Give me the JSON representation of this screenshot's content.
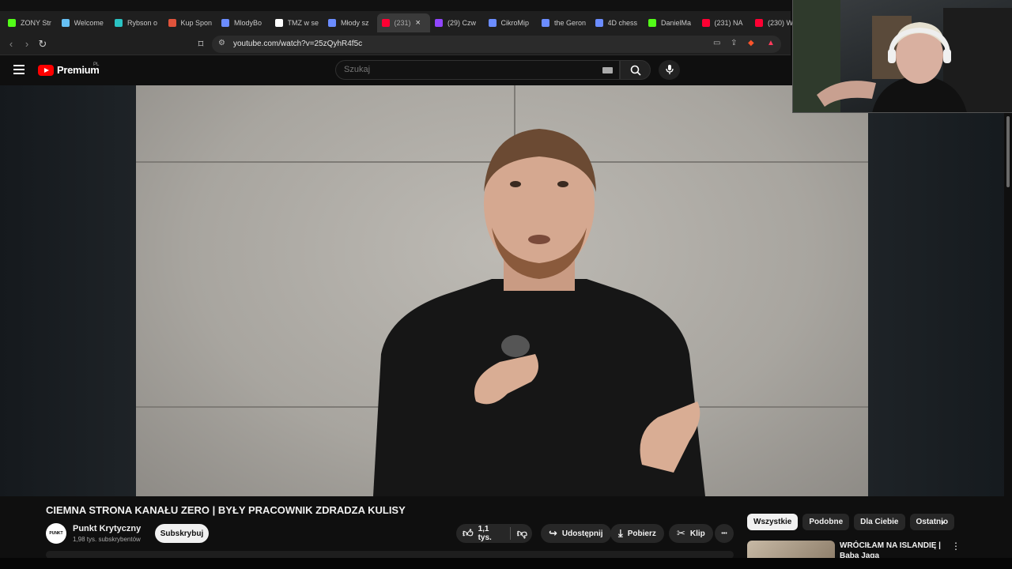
{
  "browser": {
    "tabs": [
      {
        "title": "ZONY Str",
        "favicon_color": "#53fc18",
        "active": false
      },
      {
        "title": "Welcome",
        "favicon_color": "#66c0f4",
        "active": false
      },
      {
        "title": "Rybson o",
        "favicon_color": "#2ac3c3",
        "active": false
      },
      {
        "title": "Kup Spon",
        "favicon_color": "#e0533b",
        "active": false
      },
      {
        "title": "MlodyBo",
        "favicon_color": "#6b8cff",
        "active": false
      },
      {
        "title": "TMZ w se",
        "favicon_color": "#ffffff",
        "active": false
      },
      {
        "title": "Młody sz",
        "favicon_color": "#6b8cff",
        "active": false
      },
      {
        "title": "(231)",
        "favicon_color": "#ff0033",
        "active": true
      },
      {
        "title": "(29) Czw",
        "favicon_color": "#9146ff",
        "active": false
      },
      {
        "title": "CikroMip",
        "favicon_color": "#6b8cff",
        "active": false
      },
      {
        "title": "the Geron",
        "favicon_color": "#6b8cff",
        "active": false
      },
      {
        "title": "4D chess",
        "favicon_color": "#6b8cff",
        "active": false
      },
      {
        "title": "DanielMa",
        "favicon_color": "#53fc18",
        "active": false
      },
      {
        "title": "(231) NA",
        "favicon_color": "#ff0033",
        "active": false
      },
      {
        "title": "(230) WO",
        "favicon_color": "#ff0033",
        "active": false
      }
    ],
    "tab_close_glyph": "×",
    "url": "youtube.com/watch?v=25zQyhR4f5c",
    "icons": {
      "back": "‹",
      "forward": "›",
      "reload": "↻",
      "bookmark": "⌑"
    }
  },
  "youtube": {
    "logo_text": "Premium",
    "logo_country": "PL",
    "search_placeholder": "Szukaj",
    "video": {
      "title": "CIEMNA STRONA KANAŁU ZERO | BYŁY PRACOWNIK ZDRADZA KULISY",
      "channel_name": "Punkt Krytyczny",
      "channel_avatar_text": "PUNKT KRYTYCZNY",
      "subscribers": "1,98 tys. subskrybentów",
      "subscribe_label": "Subskrybuj",
      "likes": "1,1 tys.",
      "share_label": "Udostępnij",
      "download_label": "Pobierz",
      "clip_label": "Klip",
      "more_label": "•••"
    },
    "chips": [
      "Wszystkie",
      "Podobne",
      "Dla Ciebie",
      "Ostatnio"
    ],
    "recommendation": {
      "title": "WRÓCIŁAM NA ISLANDIĘ | Baba Jaga"
    }
  },
  "colors": {
    "youtube_red": "#ff0000",
    "background": "#0f0f0f",
    "chip_active": "#f1f1f1"
  }
}
